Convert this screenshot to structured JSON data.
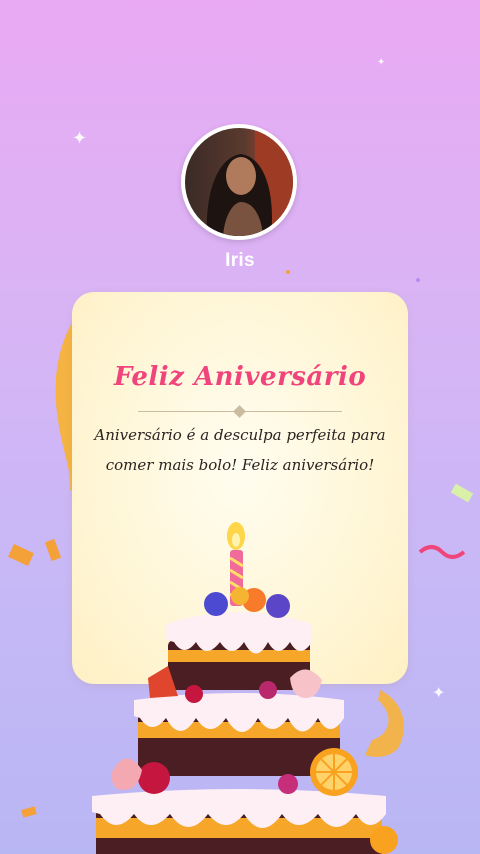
{
  "profile": {
    "name": "Iris"
  },
  "card": {
    "title": "Feliz Aniversário",
    "message_line1": "Aniversário é a desculpa perfeita para",
    "message_line2": "comer mais bolo! Feliz aniversário!"
  },
  "colors": {
    "background_top": "#e9a9f3",
    "background_bottom": "#b9b6f4",
    "title": "#f0457c",
    "card": "#fff6d6",
    "ribbon": "#f7b33a"
  }
}
